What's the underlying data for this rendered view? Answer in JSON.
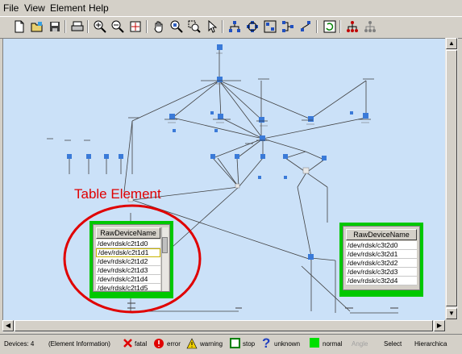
{
  "menu": {
    "file": "File",
    "view": "View",
    "element": "Element",
    "help": "Help"
  },
  "annotation": {
    "label": "Table Element"
  },
  "table_left": {
    "header": "RawDeviceName",
    "rows": [
      "/dev/rdsk/c2t1d0",
      "/dev/rdsk/c2t1d1",
      "/dev/rdsk/c2t1d2",
      "/dev/rdsk/c2t1d3",
      "/dev/rdsk/c2t1d4",
      "/dev/rdsk/c2t1d5"
    ]
  },
  "table_right": {
    "header": "RawDeviceName",
    "rows": [
      "/dev/rdsk/c3t2d0",
      "/dev/rdsk/c3t2d1",
      "/dev/rdsk/c3t2d2",
      "/dev/rdsk/c3t2d3",
      "/dev/rdsk/c3t2d4"
    ]
  },
  "status": {
    "devices": "Devices: 4",
    "element_info": "(Element Information)",
    "fatal": "fatal",
    "error": "error",
    "warning": "warning",
    "stop": "stop",
    "unknown": "unknown",
    "normal": "normal",
    "angle": "Angle",
    "select": "Select",
    "hierarchical": "Hierarchica"
  },
  "colors": {
    "canvas": "#cbe1f8",
    "table_border": "#00c800",
    "annotation": "#e00000",
    "normal": "#00e000"
  }
}
